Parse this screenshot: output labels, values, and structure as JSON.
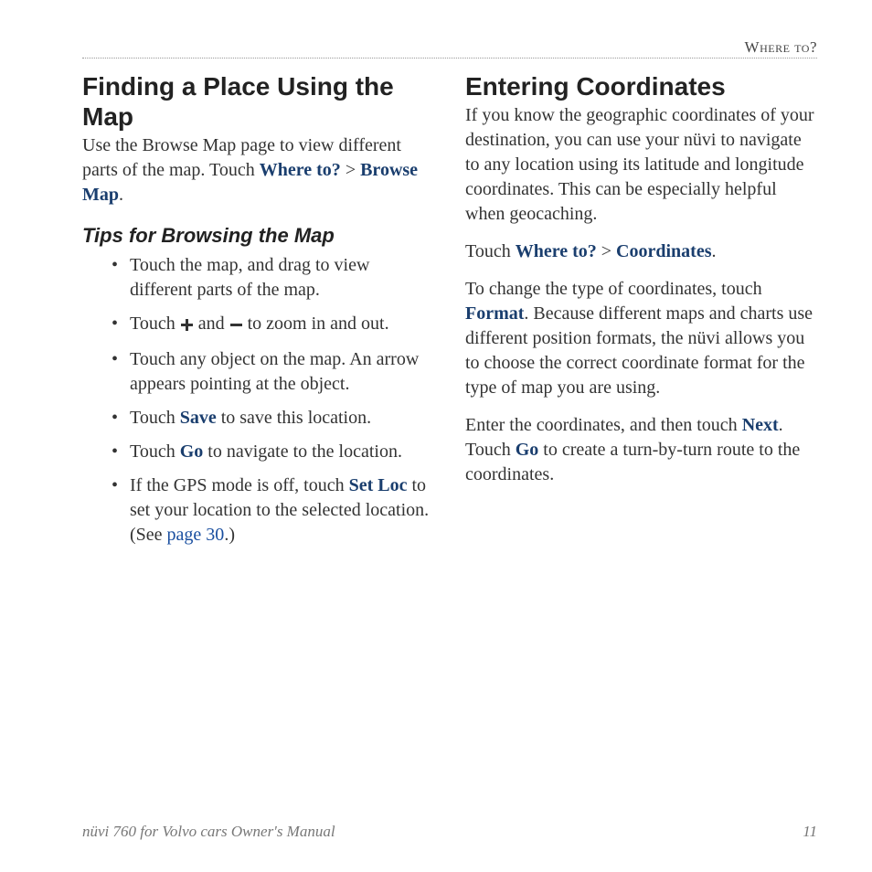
{
  "header": {
    "section": "Where to?"
  },
  "left": {
    "heading": "Finding a Place Using the Map",
    "intro_a": "Use the Browse Map page to view different parts of the map. Touch ",
    "link_where": "Where to?",
    "gt": " > ",
    "link_browse": "Browse Map",
    "period": ".",
    "subheading": "Tips for Browsing the Map",
    "tips": {
      "t1": "Touch the map, and drag to view different parts of the map.",
      "t2a": "Touch ",
      "t2b": " and ",
      "t2c": " to zoom in and out.",
      "t3": "Touch any object on the map. An arrow appears pointing at the object.",
      "t4a": "Touch ",
      "t4_save": "Save",
      "t4b": " to save this location.",
      "t5a": "Touch ",
      "t5_go": "Go",
      "t5b": " to navigate to the location.",
      "t6a": "If the GPS mode is off, touch ",
      "t6_set": "Set Loc",
      "t6b": " to set your location to the selected location. (See ",
      "t6_page": "page 30",
      "t6c": ".)"
    }
  },
  "right": {
    "heading": "Entering Coordinates",
    "p1": "If you know the geographic coordinates of your destination, you can use your nüvi to navigate to any location using its latitude and longitude coordinates. This can be especially helpful when geocaching.",
    "p2a": "Touch ",
    "p2_where": "Where to?",
    "p2_gt": " > ",
    "p2_coords": "Coordinates",
    "p2b": ".",
    "p3a": "To change the type of coordinates, touch ",
    "p3_format": "Format",
    "p3b": ". Because different maps and charts use different position formats, the nüvi allows you to choose the correct coordinate format for the type of map you are using.",
    "p4a": "Enter the coordinates, and then touch ",
    "p4_next": "Next",
    "p4b": ". Touch ",
    "p4_go": "Go",
    "p4c": " to create a turn-by-turn route to the coordinates."
  },
  "footer": {
    "title": "nüvi 760 for Volvo cars Owner's Manual",
    "page": "11"
  }
}
